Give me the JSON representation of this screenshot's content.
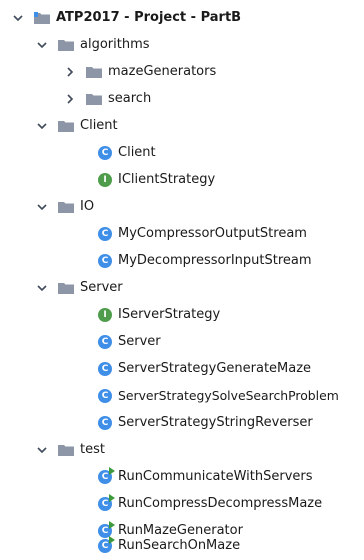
{
  "colors": {
    "folder": "#8c96a6",
    "arrow": "#3f4a5a",
    "class_badge": "#3f8ee8",
    "interface_badge": "#4f9d4c",
    "run_mark": "#3c9a3c"
  },
  "project": {
    "label": "ATP2017 - Project - PartB",
    "icon": "project-folder-icon",
    "expanded": true
  },
  "tree": {
    "algorithms": {
      "label": "algorithms",
      "expanded": true,
      "children": {
        "mazeGenerators": {
          "label": "mazeGenerators",
          "expanded": false
        },
        "search": {
          "label": "search",
          "expanded": false
        }
      }
    },
    "client": {
      "label": "Client",
      "expanded": true,
      "children": {
        "client": {
          "label": "Client",
          "kind": "class",
          "badge": "C"
        },
        "iclientstrategy": {
          "label": "IClientStrategy",
          "kind": "interface",
          "badge": "I"
        }
      }
    },
    "io": {
      "label": "IO",
      "expanded": true,
      "children": {
        "compressor": {
          "label": "MyCompressorOutputStream",
          "kind": "class",
          "badge": "C"
        },
        "decompressor": {
          "label": "MyDecompressorInputStream",
          "kind": "class",
          "badge": "C"
        }
      }
    },
    "server": {
      "label": "Server",
      "expanded": true,
      "children": {
        "iserverstrategy": {
          "label": "IServerStrategy",
          "kind": "interface",
          "badge": "I"
        },
        "server": {
          "label": "Server",
          "kind": "class",
          "badge": "C"
        },
        "generatemaze": {
          "label": "ServerStrategyGenerateMaze",
          "kind": "class",
          "badge": "C"
        },
        "solvesearch": {
          "label": "ServerStrategySolveSearchProblem",
          "kind": "class",
          "badge": "C"
        },
        "stringreverser": {
          "label": "ServerStrategyStringReverser",
          "kind": "class",
          "badge": "C"
        }
      }
    },
    "test": {
      "label": "test",
      "expanded": true,
      "children": {
        "communicate": {
          "label": "RunCommunicateWithServers",
          "kind": "runnable",
          "badge": "C"
        },
        "compressdecompress": {
          "label": "RunCompressDecompressMaze",
          "kind": "runnable",
          "badge": "C"
        },
        "mazegenerator": {
          "label": "RunMazeGenerator",
          "kind": "runnable",
          "badge": "C"
        },
        "searchonmaze": {
          "label": "RunSearchOnMaze",
          "kind": "runnable",
          "badge": "C"
        }
      }
    }
  }
}
